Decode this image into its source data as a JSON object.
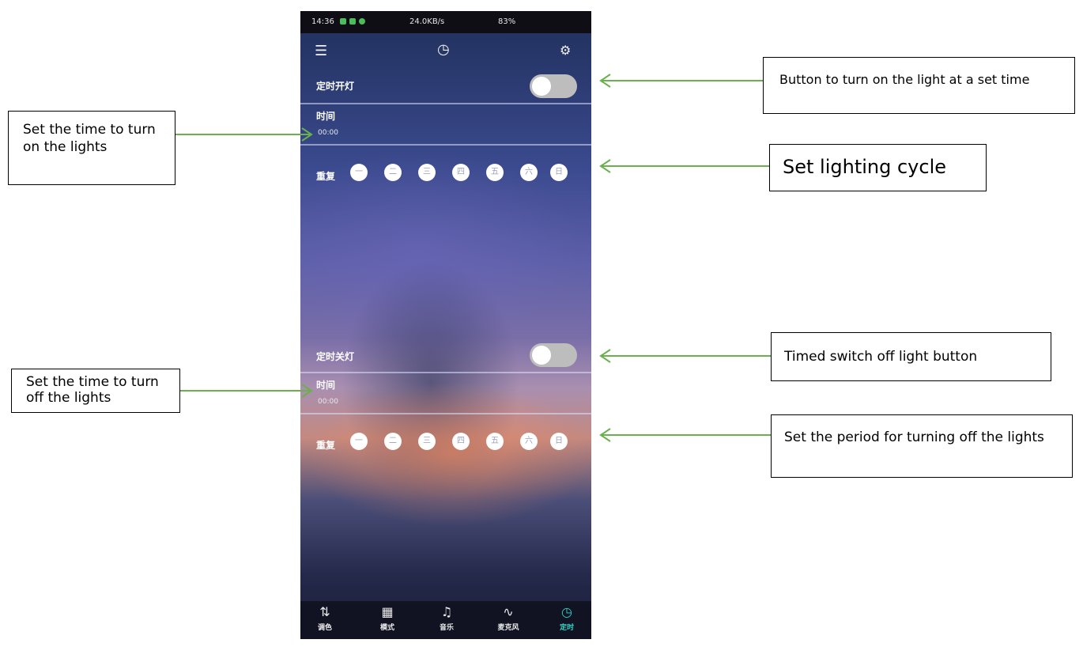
{
  "status_bar": {
    "time": "14:36",
    "network": "24.0KB/s",
    "battery": "83%"
  },
  "top_bar": {
    "menu_icon": "menu-icon",
    "clock_icon": "clock-icon",
    "settings_icon": "gear-icon"
  },
  "timer_on": {
    "label": "定时开灯",
    "time_label": "时间",
    "time_value": "00:00",
    "repeat_label": "重复",
    "days": [
      "一",
      "二",
      "三",
      "四",
      "五",
      "六",
      "日"
    ],
    "toggle_on": false
  },
  "timer_off": {
    "label": "定时关灯",
    "time_label": "时间",
    "time_value": "00:00",
    "repeat_label": "重复",
    "days": [
      "一",
      "二",
      "三",
      "四",
      "五",
      "六",
      "日"
    ],
    "toggle_on": false
  },
  "nav": [
    {
      "label": "调色",
      "icon": "sliders-icon"
    },
    {
      "label": "模式",
      "icon": "grid-icon"
    },
    {
      "label": "音乐",
      "icon": "music-icon"
    },
    {
      "label": "麦克风",
      "icon": "waveform-icon"
    },
    {
      "label": "定时",
      "icon": "timer-icon",
      "active": true
    }
  ],
  "callouts": {
    "on_time": "Set the time to turn on the lights",
    "on_button": "Button to turn on the light at a set time",
    "on_cycle": "Set lighting cycle",
    "off_button": "Timed switch off light button",
    "off_time": "Set the time to turn off the lights",
    "off_cycle": "Set the period for turning off the lights"
  },
  "colors": {
    "arrow": "#6ab04c",
    "nav_active": "#2ed3c4"
  }
}
